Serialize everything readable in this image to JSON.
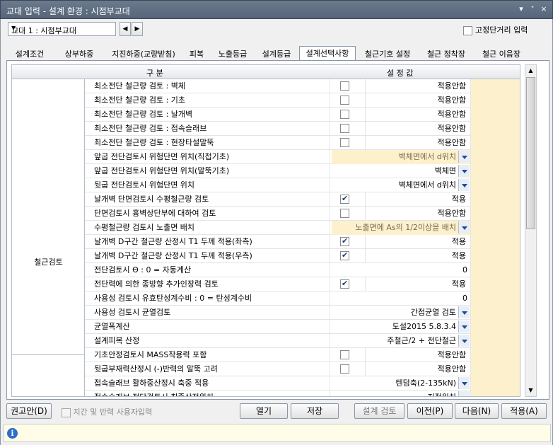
{
  "window": {
    "title": "교대 입력 - 설계 환경 : 시점부교대",
    "pin": "▾",
    "pushpin": "ᐩ",
    "close": "×"
  },
  "toolbar": {
    "selector_value": "교대 1 : 시점부교대",
    "prev": "◀",
    "next": "▶",
    "fixed_label": "고정단거리 입력"
  },
  "tabs": [
    "설계조건",
    "상부하중",
    "지진하중(교량받침)",
    "피복",
    "노출등급",
    "설계등급",
    "설계선택사항",
    "철근기호 설정",
    "철근 정착장",
    "철근 이음장"
  ],
  "active_tab_index": 6,
  "grid": {
    "header": {
      "col_item": "구        분",
      "col_value": "설 정 값"
    },
    "category": "철근검토",
    "rows": [
      {
        "name": "최소전단 철근량 검토 : 벽체",
        "type": "check",
        "checked": false,
        "value": "적용안함"
      },
      {
        "name": "최소전단 철근량 검토 : 기초",
        "type": "check",
        "checked": false,
        "value": "적용안함"
      },
      {
        "name": "최소전단 철근량 검토 : 날개벽",
        "type": "check",
        "checked": false,
        "value": "적용안함"
      },
      {
        "name": "최소전단 철근량 검토 : 접속슬래브",
        "type": "check",
        "checked": false,
        "value": "적용안함"
      },
      {
        "name": "최소전단 철근량 검토 : 현장타설말뚝",
        "type": "check",
        "checked": false,
        "value": "적용안함"
      },
      {
        "name": "앞굽 전단검토시 위험단면 위치(직접기초)",
        "type": "combo",
        "value": "벽체면에서 d위치",
        "disabled": true
      },
      {
        "name": "앞굽 전단검토시 위험단면 위치(말뚝기초)",
        "type": "combo",
        "value": "벽체면"
      },
      {
        "name": "뒷굽 전단검토시 위험단면 위치",
        "type": "combo",
        "value": "벽체면에서 d위치"
      },
      {
        "name": "날개벽 단면검토시 수평철근량 검토",
        "type": "check",
        "checked": true,
        "value": "적용"
      },
      {
        "name": "단면검토시 흉벽상단부에 대하여 검토",
        "type": "check",
        "checked": false,
        "value": "적용안함"
      },
      {
        "name": "수평철근량 검토시 노출면 배치",
        "type": "combo",
        "value": "노출면에 As의 1/2이상을 배치",
        "disabled": true
      },
      {
        "name": "날개벽 D구간 철근량 산정시 T1 두께 적용(좌측)",
        "type": "check",
        "checked": true,
        "value": "적용"
      },
      {
        "name": "날개벽 D구간 철근량 산정시 T1 두께 적용(우측)",
        "type": "check",
        "checked": true,
        "value": "적용"
      },
      {
        "name": " 전단검토시 Θ : 0 = 자동계산",
        "type": "number",
        "value": "0"
      },
      {
        "name": "전단력에 의한 종방향 추가인장력 검토",
        "type": "check",
        "checked": true,
        "value": "적용"
      },
      {
        "name": "사용성 검토시 유효탄성계수비 : 0 = 탄성계수비",
        "type": "number",
        "value": "0"
      },
      {
        "name": "사용성 검토시 균열검토",
        "type": "combo",
        "value": "간접균열 검토"
      },
      {
        "name": "균열폭계산",
        "type": "combo",
        "value": "도설2015 5.8.3.4"
      },
      {
        "name": "설계피복 산정",
        "type": "combo",
        "value": "주철근/2 + 전단철근"
      },
      {
        "name": "기초안정검토시 MASS작용력 포함",
        "type": "check",
        "checked": false,
        "value": "적용안함"
      },
      {
        "name": "뒷굽부재력산정시 (-)반력의  말뚝 고려",
        "type": "check",
        "checked": false,
        "value": "적용안함"
      },
      {
        "name": "접속슬래브 활하중산정시 축중 적용",
        "type": "combo",
        "value": "텐덤축(2-135kN)"
      },
      {
        "name": "접속슬래브 전단검토시 최종상전위치",
        "type": "combo",
        "value": "지점위치"
      }
    ]
  },
  "buttons": {
    "recommend": "권고안(D)",
    "member_reaction": "지간 및 반력 사용자입력",
    "open": "열기",
    "save": "저장",
    "check": "설계 검토",
    "prev": "이전(P)",
    "next": "다음(N)",
    "apply": "적용(A)"
  },
  "status": {
    "icon": "i"
  }
}
